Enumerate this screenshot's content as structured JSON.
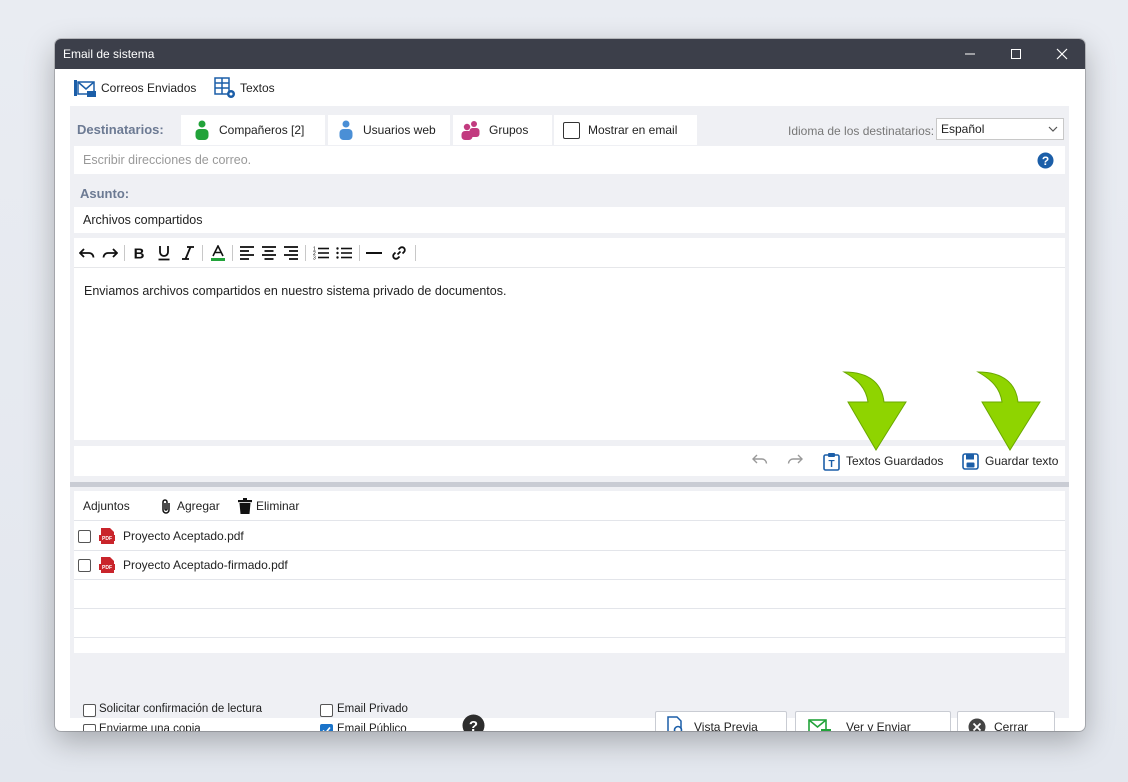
{
  "window": {
    "title": "Email de sistema"
  },
  "toolbar": {
    "sent_label": "Correos Enviados",
    "texts_label": "Textos"
  },
  "recipients": {
    "label": "Destinatarios:",
    "tabs": [
      {
        "label": "Compañeros [2]"
      },
      {
        "label": "Usuarios web"
      },
      {
        "label": "Grupos"
      }
    ],
    "show_in_email_label": "Mostrar en email",
    "language_label": "Idioma de los destinatarios:",
    "language_value": "Español",
    "address_placeholder": "Escribir direcciones de correo."
  },
  "subject": {
    "label": "Asunto:",
    "value": "Archivos compartidos"
  },
  "editor": {
    "body": "Enviamos archivos compartidos en nuestro sistema privado de documentos.",
    "saved_texts_label": "Textos Guardados",
    "save_text_label": "Guardar texto"
  },
  "attachments": {
    "label": "Adjuntos",
    "add_label": "Agregar",
    "delete_label": "Eliminar",
    "files": [
      {
        "name": "Proyecto Aceptado.pdf"
      },
      {
        "name": "Proyecto Aceptado-firmado.pdf"
      }
    ]
  },
  "options": {
    "read_confirmation": "Solicitar confirmación de lectura",
    "send_copy": "Enviarme una copia",
    "private_email": "Email Privado",
    "public_email": "Email Público",
    "public_checked": true
  },
  "buttons": {
    "preview": "Vista Previa",
    "view_send": "Ver y Enviar",
    "close": "Cerrar"
  },
  "colors": {
    "titlebar": "#3c3f4a",
    "accent": "#1b5ea8",
    "arrow": "#8fd400",
    "panel": "#eff0f4"
  }
}
